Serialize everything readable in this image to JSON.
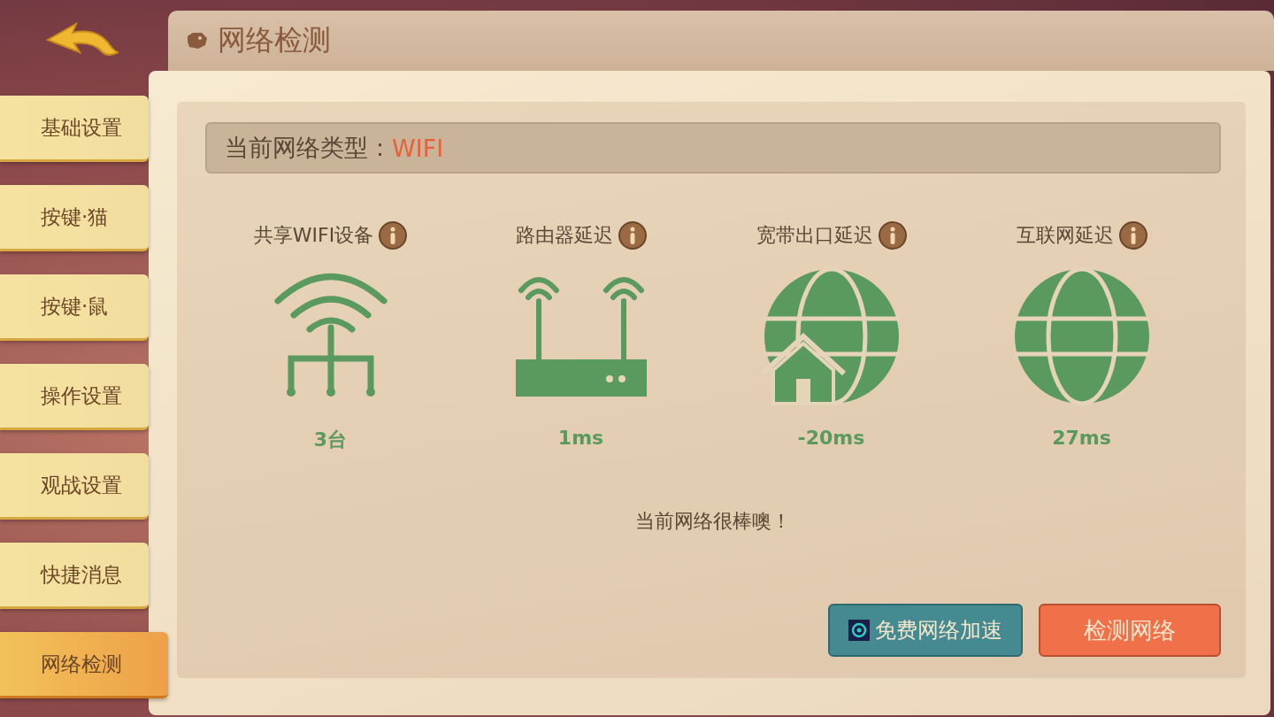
{
  "sidebar": {
    "items": [
      {
        "label": "基础设置",
        "selected": false
      },
      {
        "label": "按键·猫",
        "selected": false
      },
      {
        "label": "按键·鼠",
        "selected": false
      },
      {
        "label": "操作设置",
        "selected": false
      },
      {
        "label": "观战设置",
        "selected": false
      },
      {
        "label": "快捷消息",
        "selected": false
      },
      {
        "label": "网络检测",
        "selected": true
      }
    ]
  },
  "title": "网络检测",
  "network_type": {
    "label": "当前网络类型：",
    "value": "WIFI"
  },
  "metrics": [
    {
      "kind": "devices",
      "label": "共享WIFI设备",
      "value": "3台"
    },
    {
      "kind": "router",
      "label": "路由器延迟",
      "value": "1ms"
    },
    {
      "kind": "broadband",
      "label": "宽带出口延迟",
      "value": "-20ms"
    },
    {
      "kind": "internet",
      "label": "互联网延迟",
      "value": "27ms"
    }
  ],
  "message": "当前网络很棒噢！",
  "buttons": [
    {
      "kind": "boost",
      "label": "免费网络加速"
    },
    {
      "kind": "test",
      "label": "检测网络"
    }
  ]
}
